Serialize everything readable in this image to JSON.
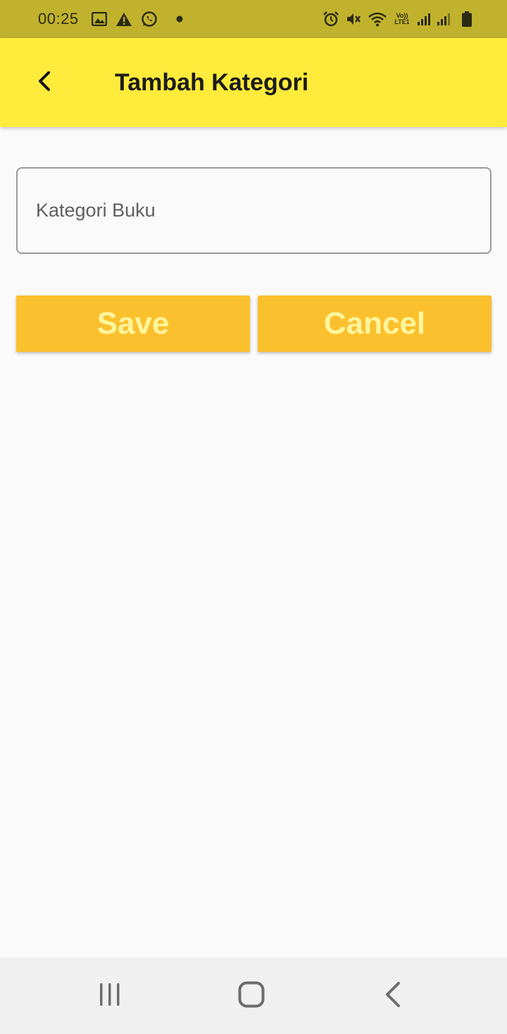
{
  "status_bar": {
    "time": "00:25",
    "left_icons": [
      "gallery-icon",
      "warning-icon",
      "whatsapp-icon",
      "dot-icon"
    ],
    "right_icons": [
      "alarm-icon",
      "mute-icon",
      "wifi-icon",
      "volte-icon",
      "signal-icon",
      "signal-icon",
      "battery-icon"
    ],
    "volte_label": "Vo)) LTE1"
  },
  "app_bar": {
    "title": "Tambah Kategori",
    "back_icon": "chevron-left-icon",
    "background": "#ffeb3b"
  },
  "form": {
    "category_field": {
      "placeholder": "Kategori Buku",
      "value": ""
    }
  },
  "actions": {
    "save_label": "Save",
    "cancel_label": "Cancel",
    "button_color": "#fbc02d",
    "button_text_color": "#fff59d"
  },
  "nav_bar": {
    "recent_icon": "recent-apps-icon",
    "home_icon": "home-icon",
    "back_icon": "back-icon"
  }
}
